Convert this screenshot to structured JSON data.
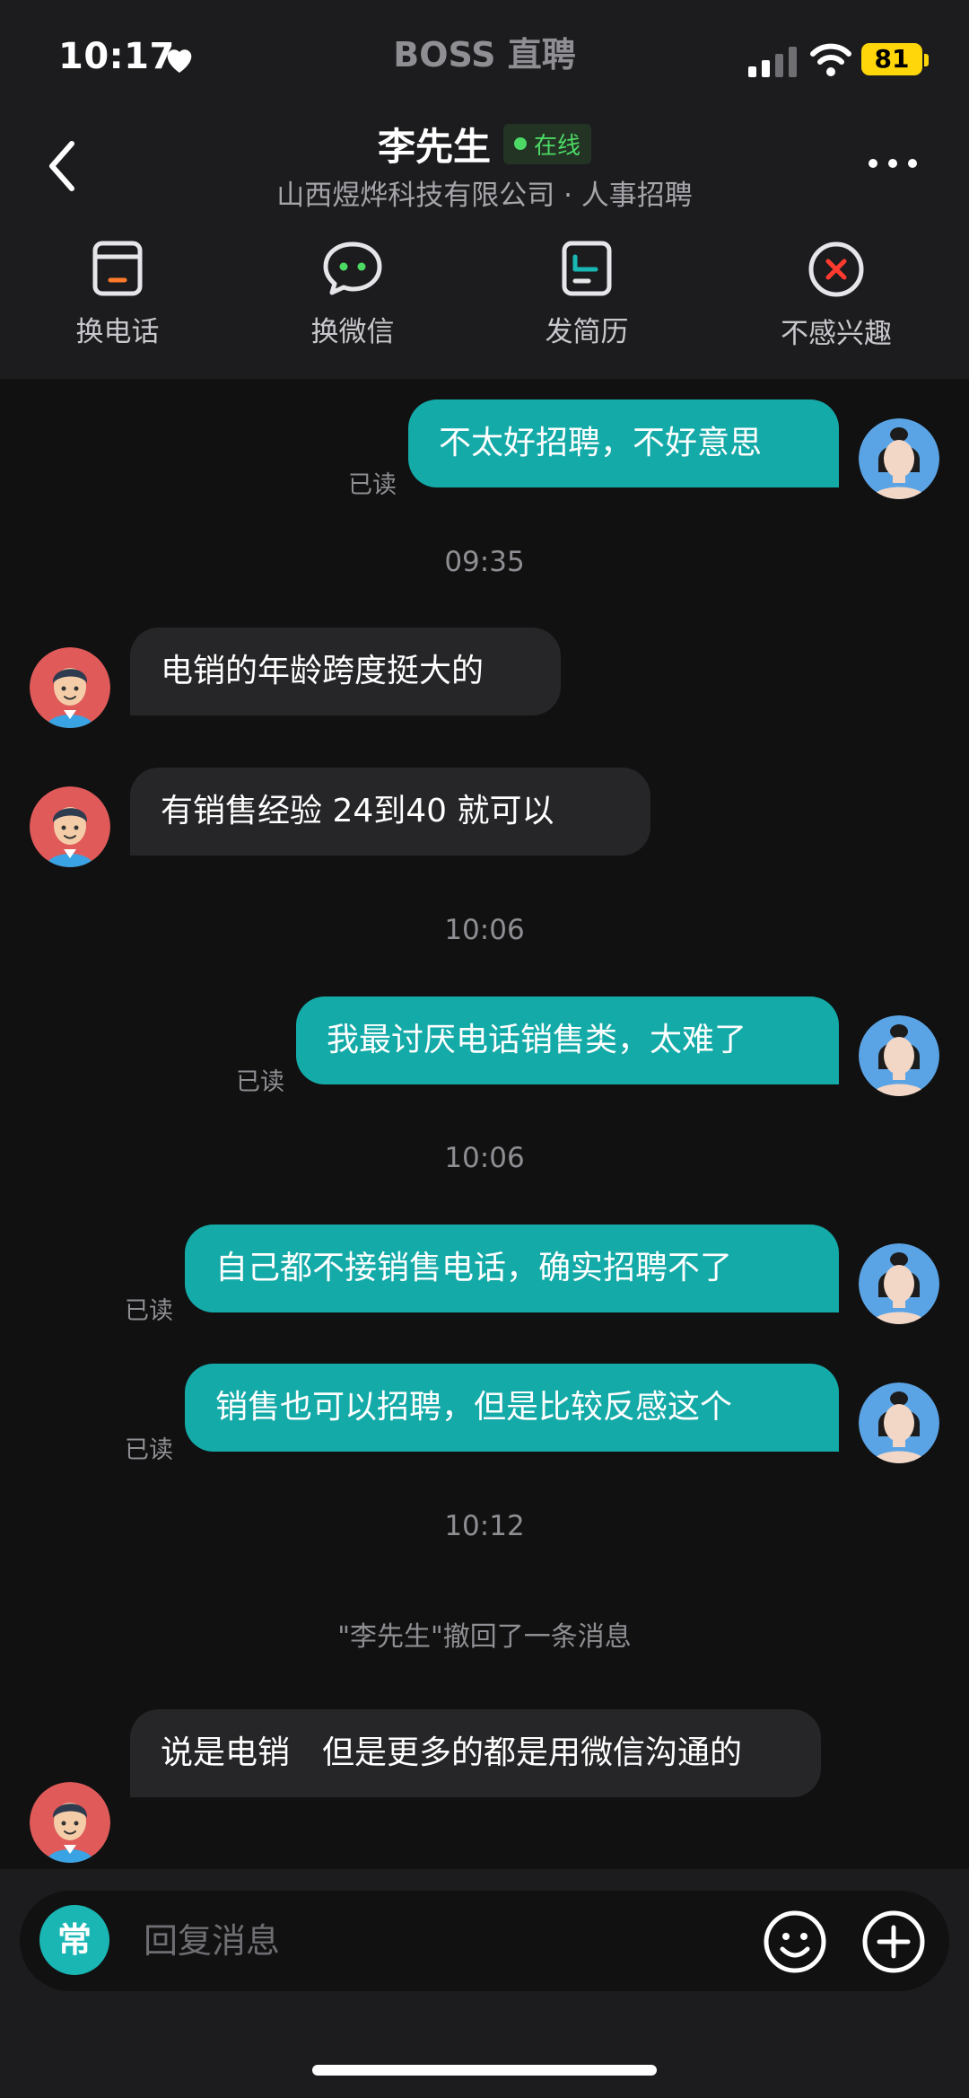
{
  "status_bar": {
    "time": "10:17",
    "app_name": "BOSS 直聘",
    "battery": "81",
    "icons": [
      "heart-icon",
      "signal-icon",
      "wifi-icon",
      "battery-icon"
    ]
  },
  "header": {
    "contact_name": "李先生",
    "online_label": "在线",
    "company": "山西煜烨科技有限公司 · 人事招聘",
    "actions": [
      {
        "label": "换电话",
        "icon": "phone-card-icon"
      },
      {
        "label": "换微信",
        "icon": "chat-bubble-icon"
      },
      {
        "label": "发简历",
        "icon": "resume-icon"
      },
      {
        "label": "不感兴趣",
        "icon": "close-circle-icon"
      }
    ]
  },
  "messages": {
    "m1": {
      "text": "不太好招聘，不好意思",
      "status": "已读",
      "sender": "me"
    },
    "t1": "09:35",
    "m2": {
      "text": "电销的年龄跨度挺大的",
      "sender": "contact"
    },
    "m3": {
      "text": "有销售经验  24到40 就可以",
      "sender": "contact"
    },
    "t2": "10:06",
    "m4": {
      "text": "我最讨厌电话销售类，太难了",
      "status": "已读",
      "sender": "me"
    },
    "t3": "10:06",
    "m5": {
      "text": "自己都不接销售电话，确实招聘不了",
      "status": "已读",
      "sender": "me"
    },
    "m6": {
      "text": "销售也可以招聘，但是比较反感这个",
      "status": "已读",
      "sender": "me"
    },
    "t4": "10:12",
    "recall": "\"李先生\"撤回了一条消息",
    "m7": {
      "text": "说是电销　但是更多的都是用微信沟通的",
      "sender": "contact"
    }
  },
  "input_bar": {
    "common_label": "常",
    "placeholder": "回复消息"
  },
  "colors": {
    "background": "#111111",
    "header_bg": "#1c1c1e",
    "outgoing_bubble": "#14aaa8",
    "incoming_bubble": "#262628",
    "online_green": "#4cd964",
    "battery_yellow": "#ffd60a"
  }
}
